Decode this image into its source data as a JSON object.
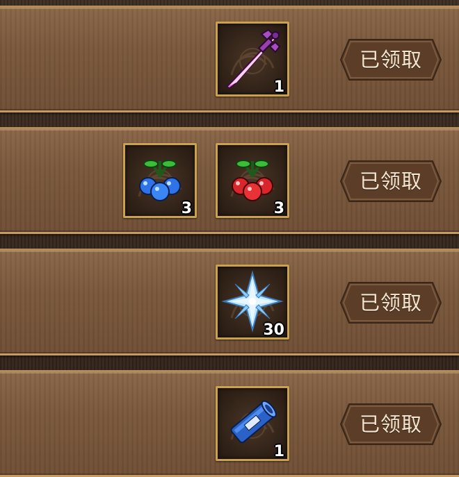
{
  "rewards": [
    {
      "items": [
        {
          "icon": "purple-sword-icon",
          "qty": "1"
        }
      ],
      "status": "已领取"
    },
    {
      "items": [
        {
          "icon": "blue-berries-icon",
          "qty": "3"
        },
        {
          "icon": "red-berries-icon",
          "qty": "3"
        }
      ],
      "status": "已领取"
    },
    {
      "items": [
        {
          "icon": "ice-crystal-icon",
          "qty": "30"
        }
      ],
      "status": "已领取"
    },
    {
      "items": [
        {
          "icon": "blue-scroll-icon",
          "qty": "1"
        }
      ],
      "status": "已领取"
    }
  ],
  "colors": {
    "panel": "#7a583c",
    "slot_border": "#c9a14f",
    "button": "#5b3d28",
    "button_text": "#f4e6cf"
  }
}
